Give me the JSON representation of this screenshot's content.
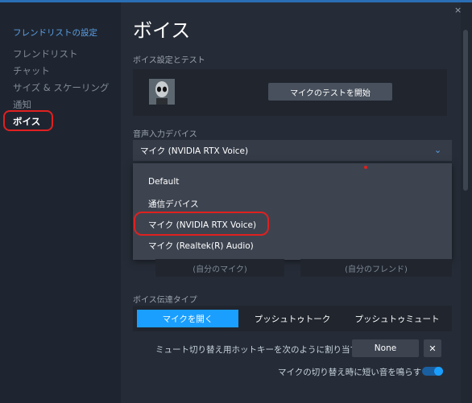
{
  "sidebar": {
    "heading": "フレンドリストの設定",
    "items": [
      {
        "label": "フレンドリスト"
      },
      {
        "label": "チャット"
      },
      {
        "label": "サイズ & スケーリング"
      },
      {
        "label": "通知"
      },
      {
        "label": "ボイス"
      }
    ]
  },
  "main": {
    "title": "ボイス",
    "close": "×",
    "test_section": {
      "label": "ボイス設定とテスト",
      "button": "マイクのテストを開始"
    },
    "input_device": {
      "label": "音声入力デバイス",
      "selected": "マイク (NVIDIA RTX Voice)",
      "chevron": "⌄",
      "options": [
        "Default",
        "通信デバイス",
        "マイク (NVIDIA RTX Voice)",
        "マイク (Realtek(R) Audio)"
      ]
    },
    "meters": {
      "mine": "(自分のマイク)",
      "friend": "(自分のフレンド)"
    },
    "transmission": {
      "label": "ボイス伝達タイプ",
      "options": [
        "マイクを開く",
        "プッシュトゥトーク",
        "プッシュトゥミュート"
      ],
      "selected_index": 0
    },
    "mute_hotkey": {
      "label": "ミュート切り替え用ホットキーを次のように割り当て",
      "value": "None",
      "clear": "✕"
    },
    "beep": {
      "label": "マイクの切り替え時に短い音を鳴らす",
      "enabled": true
    }
  },
  "colors": {
    "accent": "#1a9fff",
    "highlight": "#e02020"
  }
}
